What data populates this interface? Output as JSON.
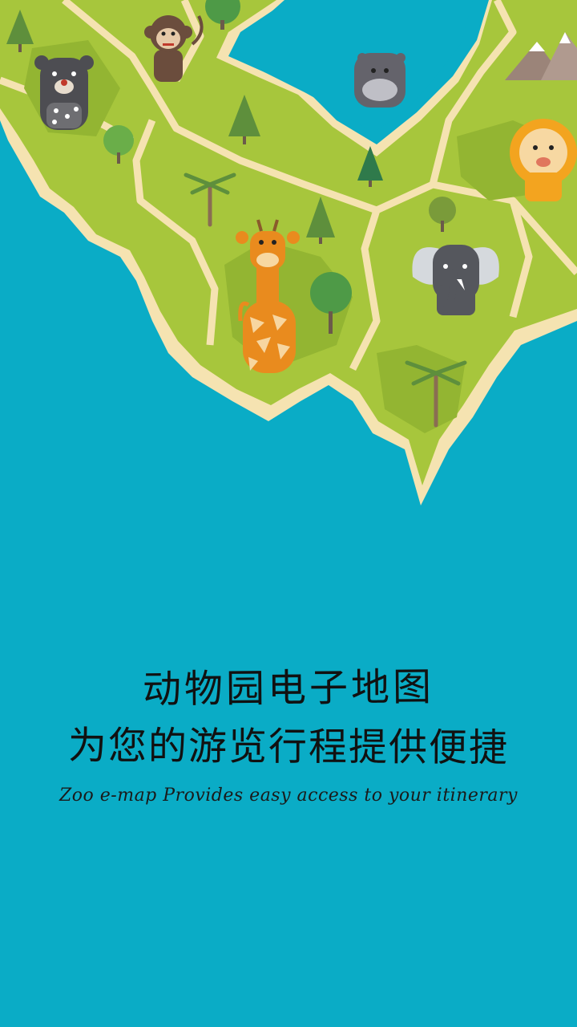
{
  "splash": {
    "title_cn_1": "动物园电子地图",
    "title_cn_2": "为您的游览行程提供便捷",
    "subtitle_en": "Zoo e-map Provides easy access to your itinerary"
  },
  "colors": {
    "water": "#0aacc6",
    "land": "#a7c63c",
    "beach": "#f5e3b1",
    "forest_patch": "#93b532",
    "tree_dark": "#5e8f3c",
    "giraffe": "#e98b1e",
    "lion_mane": "#f3a41f"
  },
  "icons": [
    "bear-icon",
    "monkey-icon",
    "hippo-icon",
    "lion-icon",
    "giraffe-icon",
    "elephant-icon",
    "tree-icon",
    "palm-icon",
    "mountain-icon"
  ]
}
